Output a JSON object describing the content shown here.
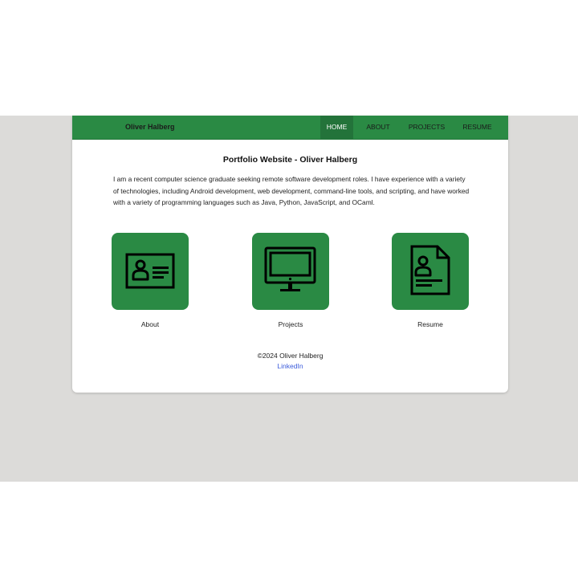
{
  "nav": {
    "brand": "Oliver Halberg",
    "items": [
      {
        "label": "HOME",
        "active": true
      },
      {
        "label": "ABOUT",
        "active": false
      },
      {
        "label": "PROJECTS",
        "active": false
      },
      {
        "label": "RESUME",
        "active": false
      }
    ]
  },
  "main": {
    "title": "Portfolio Website - Oliver Halberg",
    "intro": "I am a recent computer science graduate seeking remote software development roles. I have experience with a variety of technologies, including Android development, web development, command-line tools, and scripting, and have worked with a variety of programming languages such as Java, Python, JavaScript, and OCaml.",
    "tiles": [
      {
        "label": "About",
        "icon": "id-card-icon"
      },
      {
        "label": "Projects",
        "icon": "monitor-icon"
      },
      {
        "label": "Resume",
        "icon": "document-user-icon"
      }
    ]
  },
  "footer": {
    "copyright": "©2024 Oliver Halberg",
    "link": "LinkedIn"
  },
  "colors": {
    "accent": "#2a8a44",
    "nav_active": "#23733a",
    "page_band": "#dcdbd9",
    "link": "#3b5bdb"
  }
}
